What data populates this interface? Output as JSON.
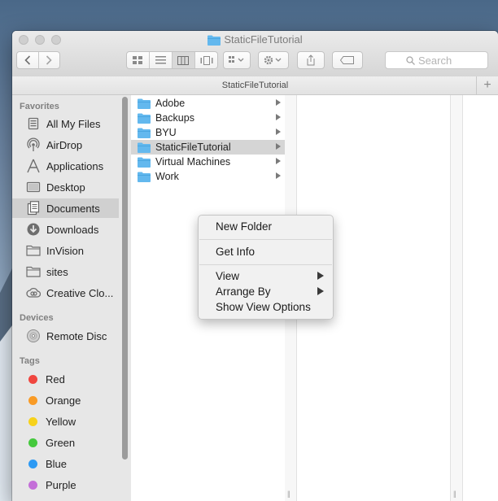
{
  "window": {
    "title": "StaticFileTutorial",
    "path_title": "StaticFileTutorial"
  },
  "toolbar": {
    "back_icon": "chevron-left",
    "forward_icon": "chevron-right",
    "view_modes": [
      "icon-view",
      "list-view",
      "column-view",
      "cover-flow-view"
    ],
    "active_view": "column-view",
    "search_placeholder": "Search"
  },
  "sidebar": {
    "favorites_header": "Favorites",
    "favorites": [
      {
        "label": "All My Files",
        "icon": "all-files-icon"
      },
      {
        "label": "AirDrop",
        "icon": "airdrop-icon"
      },
      {
        "label": "Applications",
        "icon": "applications-icon"
      },
      {
        "label": "Desktop",
        "icon": "desktop-icon"
      },
      {
        "label": "Documents",
        "icon": "documents-icon",
        "selected": true
      },
      {
        "label": "Downloads",
        "icon": "downloads-icon"
      },
      {
        "label": "InVision",
        "icon": "folder-icon"
      },
      {
        "label": "sites",
        "icon": "folder-icon"
      },
      {
        "label": "Creative Clo...",
        "icon": "creative-cloud-icon"
      }
    ],
    "devices_header": "Devices",
    "devices": [
      {
        "label": "Remote Disc",
        "icon": "disc-icon"
      }
    ],
    "tags_header": "Tags",
    "tags": [
      {
        "label": "Red",
        "color": "#f0463f"
      },
      {
        "label": "Orange",
        "color": "#f99b26"
      },
      {
        "label": "Yellow",
        "color": "#f7d21b"
      },
      {
        "label": "Green",
        "color": "#45c93d"
      },
      {
        "label": "Blue",
        "color": "#2d9af4"
      },
      {
        "label": "Purple",
        "color": "#c46fd8"
      }
    ]
  },
  "column1": {
    "items": [
      {
        "label": "Adobe"
      },
      {
        "label": "Backups"
      },
      {
        "label": "BYU"
      },
      {
        "label": "StaticFileTutorial",
        "selected": true
      },
      {
        "label": "Virtual Machines"
      },
      {
        "label": "Work"
      }
    ]
  },
  "context_menu": {
    "new_folder": "New Folder",
    "get_info": "Get Info",
    "view": "View",
    "arrange_by": "Arrange By",
    "show_view_options": "Show View Options"
  },
  "colors": {
    "folder_blue": "#63b8ee",
    "selection_gray": "#d5d5d5"
  }
}
